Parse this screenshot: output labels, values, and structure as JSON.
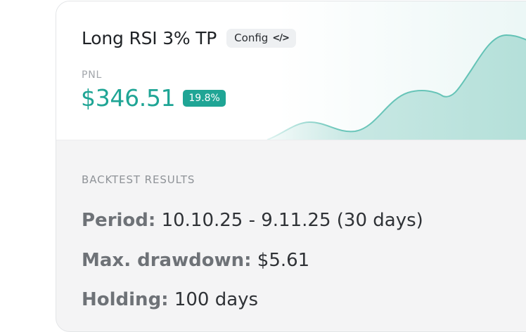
{
  "strategy": {
    "title": "Long RSI 3% TP",
    "config_label": "Config",
    "config_icon": "code-icon"
  },
  "pnl": {
    "label": "PNL",
    "value": "$346.51",
    "percent": "19.8%"
  },
  "colors": {
    "accent": "#1fa595",
    "chart_fill": "#bfe4df"
  },
  "backtest": {
    "section_label": "BACKTEST RESULTS",
    "results": [
      {
        "key": "Period:",
        "value": "10.10.25 - 9.11.25 (30 days)"
      },
      {
        "key": "Max. drawdown:",
        "value": "$5.61"
      },
      {
        "key": "Holding:",
        "value": "100 days"
      }
    ]
  }
}
